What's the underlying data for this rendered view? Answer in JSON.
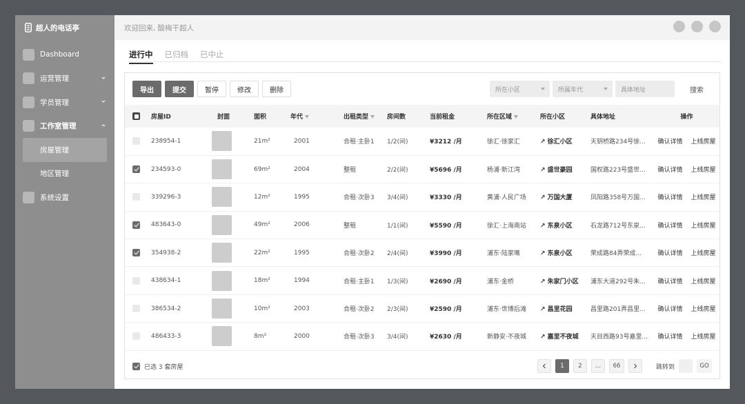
{
  "app": {
    "brand": "超人的电话亭",
    "welcome": "欢迎回来, 酸梅干超人"
  },
  "sidebar": {
    "items": [
      {
        "label": "Dashboard"
      },
      {
        "label": "运营管理"
      },
      {
        "label": "学员管理"
      },
      {
        "label": "工作室管理"
      },
      {
        "label": "系统设置"
      }
    ],
    "subitems": [
      {
        "label": "房屋管理"
      },
      {
        "label": "地区管理"
      }
    ]
  },
  "tabs": [
    {
      "label": "进行中"
    },
    {
      "label": "已归档"
    },
    {
      "label": "已中止"
    }
  ],
  "toolbar": {
    "export": "导出",
    "submit": "提交",
    "pause": "暂停",
    "edit": "修改",
    "delete": "删除"
  },
  "filters": {
    "community": "所在小区",
    "year": "所属年代",
    "address": "具体地址",
    "search": "搜索"
  },
  "table": {
    "headers": {
      "id": "房屋ID",
      "cover": "封面",
      "area": "面积",
      "year": "年代",
      "type": "出租类型",
      "rooms": "房间数",
      "rent": "当前租金",
      "region": "所在区域",
      "community": "所在小区",
      "address": "具体地址",
      "ops": "操作"
    },
    "rows": [
      {
        "id": "238954-1",
        "area": "21m²",
        "year": "2001",
        "type": "合租·主卧1",
        "rooms": "1/2(间)",
        "rent": "¥3212 /月",
        "region": "徐汇·徐家汇",
        "community": "↗ 徐汇小区",
        "address": "天钥桥路234号徐...",
        "op1": "确认详情",
        "op2": "上线房屋",
        "checked": false
      },
      {
        "id": "234593-0",
        "area": "69m²",
        "year": "2004",
        "type": "整租",
        "rooms": "2/2(间)",
        "rent": "¥5696 /月",
        "region": "杨浦·新江湾",
        "community": "↗ 盛世豪园",
        "address": "国权路223号盛世...",
        "op1": "确认详情",
        "op2": "上线房屋",
        "checked": true
      },
      {
        "id": "339296-3",
        "area": "12m²",
        "year": "1995",
        "type": "合租·次卧3",
        "rooms": "3/4(间)",
        "rent": "¥3330 /月",
        "region": "黄浦·人民广场",
        "community": "↗ 万国大厦",
        "address": "凤阳路358号万国...",
        "op1": "确认详情",
        "op2": "上线房屋",
        "checked": false
      },
      {
        "id": "483643-0",
        "area": "49m²",
        "year": "2006",
        "type": "整租",
        "rooms": "1/1(间)",
        "rent": "¥5590 /月",
        "region": "徐汇·上海南站",
        "community": "↗ 东泉小区",
        "address": "石龙路712号东泉...",
        "op1": "确认详情",
        "op2": "上线房屋",
        "checked": true
      },
      {
        "id": "354938-2",
        "area": "22m²",
        "year": "1995",
        "type": "合租·次卧2",
        "rooms": "2/4(间)",
        "rent": "¥3990 /月",
        "region": "浦东·陆家嘴",
        "community": "↗ 东泉小区",
        "address": "荣成路84弄荣成...",
        "op1": "确认详情",
        "op2": "上线房屋",
        "checked": true
      },
      {
        "id": "438634-1",
        "area": "18m²",
        "year": "1994",
        "type": "合租·主卧1",
        "rooms": "1/3(间)",
        "rent": "¥2690 /月",
        "region": "浦东·金桥",
        "community": "↗ 朱家门小区",
        "address": "浦东大道292号朱...",
        "op1": "确认详情",
        "op2": "上线房屋",
        "checked": false
      },
      {
        "id": "386534-2",
        "area": "10m²",
        "year": "2003",
        "type": "合租·次卧2",
        "rooms": "2/3(间)",
        "rent": "¥2590 /月",
        "region": "浦东·世博后滩",
        "community": "↗ 昌里花园",
        "address": "昌里路201弄昌里...",
        "op1": "确认详情",
        "op2": "上线房屋",
        "checked": false
      },
      {
        "id": "486433-3",
        "area": "8m²",
        "year": "2000",
        "type": "合租·次卧3",
        "rooms": "3/4(间)",
        "rent": "¥2630 /月",
        "region": "新静安·不夜城",
        "community": "↗ 嘉里不夜城",
        "address": "天目西路93号嘉里...",
        "op1": "确认详情",
        "op2": "上线房屋",
        "checked": false
      }
    ]
  },
  "footer": {
    "selected": "已选 3 套房屋",
    "pages": [
      "1",
      "2",
      "...",
      "66"
    ],
    "jump": "跳转到",
    "go": "GO"
  }
}
